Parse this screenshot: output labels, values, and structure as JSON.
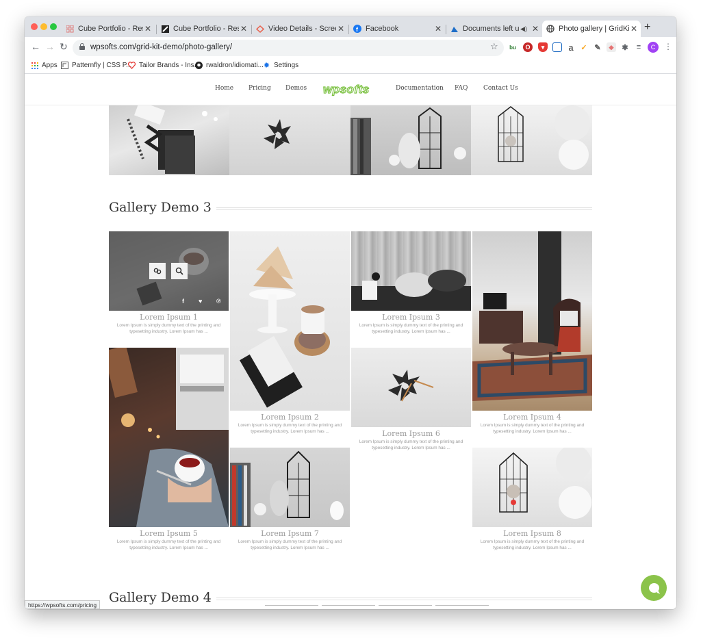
{
  "browser": {
    "tabs": [
      {
        "title": "Cube Portfolio - Responsive",
        "icon": "grid-icon"
      },
      {
        "title": "Cube Portfolio - Responsive",
        "icon": "stripe-icon"
      },
      {
        "title": "Video Details - Screencastify",
        "icon": "screencast-icon"
      },
      {
        "title": "Facebook",
        "icon": "facebook-icon"
      },
      {
        "title": "Documents left unsecured",
        "icon": "mountain-icon",
        "audio": true
      },
      {
        "title": "Photo gallery | GridKit by WPSofts",
        "icon": "globe-icon",
        "active": true
      }
    ],
    "url": "wpsofts.com/grid-kit-demo/photo-gallery/",
    "bookmarks": [
      {
        "label": "Apps",
        "icon": "apps-grid-icon"
      },
      {
        "label": "Patternfly | CSS P...",
        "icon": "patternfly-icon"
      },
      {
        "label": "Tailor Brands - Ins...",
        "icon": "tailor-brands-icon"
      },
      {
        "label": "rwaldron/idiomati...",
        "icon": "github-icon"
      },
      {
        "label": "Settings",
        "icon": "gear-icon"
      }
    ],
    "status_url": "https://wpsofts.com/pricing",
    "profile_initial": "C"
  },
  "site": {
    "nav": {
      "home": "Home",
      "pricing": "Pricing",
      "demos": "Demos",
      "logo": "wpsofts",
      "documentation": "Documentation",
      "faq": "FAQ",
      "contact": "Contact Us"
    },
    "accent": "#7bc142"
  },
  "gallery3": {
    "title": "Gallery Demo 3",
    "items": [
      {
        "title": "Lorem Ipsum 1",
        "text": "Lorem Ipsum is simply dummy text of the printing and typesetting industry. Lorem Ipsum has ..."
      },
      {
        "title": "Lorem Ipsum 2",
        "text": "Lorem Ipsum is simply dummy text of the printing and typesetting industry. Lorem Ipsum has ..."
      },
      {
        "title": "Lorem Ipsum 3",
        "text": "Lorem Ipsum is simply dummy text of the printing and typesetting industry. Lorem Ipsum has ..."
      },
      {
        "title": "Lorem Ipsum 4",
        "text": "Lorem Ipsum is simply dummy text of the printing and typesetting industry. Lorem Ipsum has ..."
      },
      {
        "title": "Lorem Ipsum 5",
        "text": "Lorem Ipsum is simply dummy text of the printing and typesetting industry. Lorem Ipsum has ..."
      },
      {
        "title": "Lorem Ipsum 6",
        "text": "Lorem Ipsum is simply dummy text of the printing and typesetting industry. Lorem Ipsum has ..."
      },
      {
        "title": "Lorem Ipsum 7",
        "text": "Lorem Ipsum is simply dummy text of the printing and typesetting industry. Lorem Ipsum has ..."
      },
      {
        "title": "Lorem Ipsum 8",
        "text": "Lorem Ipsum is simply dummy text of the printing and typesetting industry. Lorem Ipsum has ..."
      }
    ]
  },
  "gallery4": {
    "title": "Gallery Demo 4"
  },
  "overlay_icons": [
    "link-icon",
    "search-icon",
    "facebook-icon",
    "twitter-icon",
    "pinterest-icon"
  ]
}
